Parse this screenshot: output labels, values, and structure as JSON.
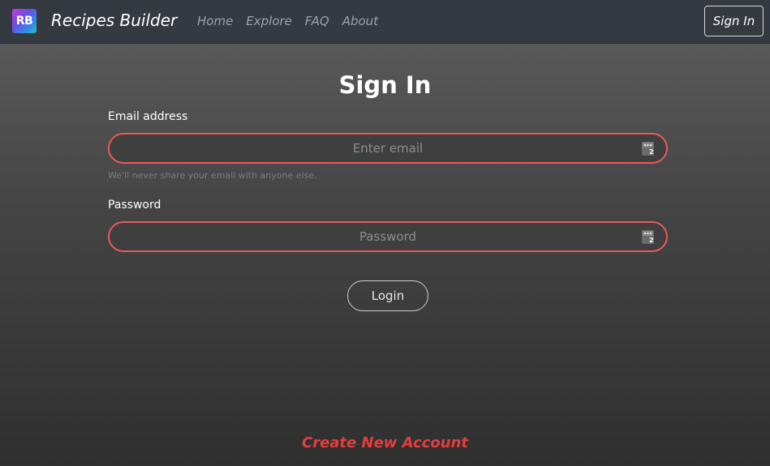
{
  "navbar": {
    "logo_text": "RB",
    "brand": "Recipes Builder",
    "links": [
      "Home",
      "Explore",
      "FAQ",
      "About"
    ],
    "signin_label": "Sign In"
  },
  "form": {
    "title": "Sign In",
    "email_label": "Email address",
    "email_placeholder": "Enter email",
    "email_help": "We'll never share your email with anyone else.",
    "password_label": "Password",
    "password_placeholder": "Password",
    "login_label": "Login"
  },
  "footer": {
    "create_account": "Create New Account"
  },
  "colors": {
    "accent_red": "#e83c3c",
    "field_border": "#e85a5a",
    "navbar": "#343a40"
  },
  "icons": {
    "field_icon": "password-manager-key-icon"
  }
}
